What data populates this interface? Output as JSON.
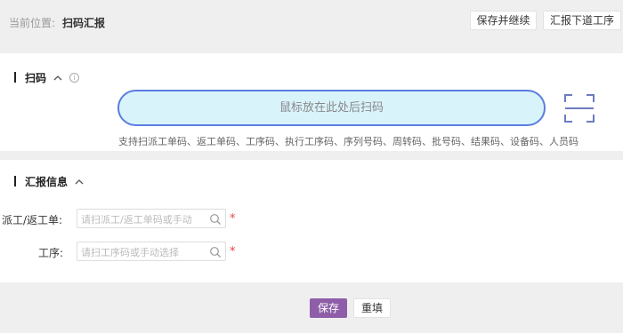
{
  "header": {
    "breadcrumb_label": "当前位置:",
    "breadcrumb_current": "扫码汇报",
    "save_continue_label": "保存并继续",
    "report_next_label": "汇报下道工序"
  },
  "scan": {
    "title": "扫码",
    "collapse_icon": "chevron-up-icon",
    "info_icon": "info-icon",
    "input_placeholder": "鼠标放在此处后扫码",
    "scan_icon": "scan-frame-icon",
    "hint": "支持扫派工单码、返工单码、工序码、执行工序码、序列号码、周转码、批号码、结果码、设备码、人员码"
  },
  "report": {
    "title": "汇报信息",
    "collapse_icon": "chevron-up-icon",
    "fields": [
      {
        "label": "派工/返工单:",
        "placeholder": "请扫派工/返工单码或手动",
        "required": "*",
        "icon": "search-icon"
      },
      {
        "label": "工序:",
        "placeholder": "请扫工序码或手动选择",
        "required": "*",
        "icon": "search-icon"
      }
    ]
  },
  "footer": {
    "save_label": "保存",
    "reset_label": "重填"
  },
  "colors": {
    "primary": "#8e5ea8",
    "scan_border": "#5a7de0",
    "scan_bg": "#d9f3fb",
    "required": "#e54545"
  }
}
